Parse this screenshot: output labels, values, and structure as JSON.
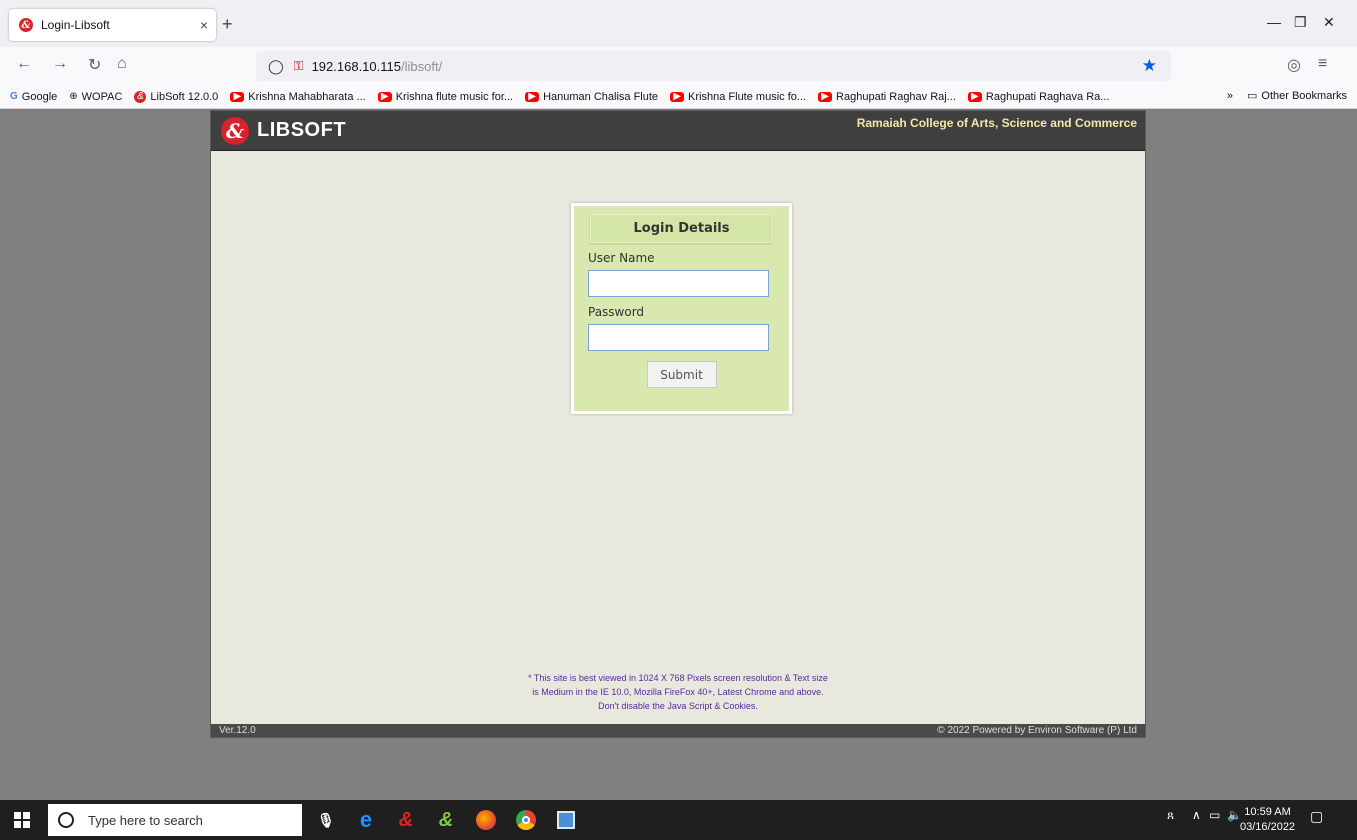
{
  "browser": {
    "tab_title": "Login-Libsoft",
    "tab_close": "×",
    "new_tab": "+",
    "url_host": "192.168.10.115",
    "url_path": "/libsoft/",
    "bookmarks": [
      {
        "label": "Google",
        "icon": "google-icon"
      },
      {
        "label": "WOPAC",
        "icon": "globe-icon"
      },
      {
        "label": "LibSoft 12.0.0",
        "icon": "libsoft-icon"
      },
      {
        "label": "Krishna Mahabharata ...",
        "icon": "youtube-icon"
      },
      {
        "label": "Krishna flute music for...",
        "icon": "youtube-icon"
      },
      {
        "label": "Hanuman Chalisa Flute",
        "icon": "youtube-icon"
      },
      {
        "label": "Krishna Flute music fo...",
        "icon": "youtube-icon"
      },
      {
        "label": "Raghupati Raghav Raj...",
        "icon": "youtube-icon"
      },
      {
        "label": "Raghupati Raghava Ra...",
        "icon": "youtube-icon"
      }
    ],
    "other_bookmarks": "Other Bookmarks"
  },
  "header": {
    "logo_text": "LIBSOFT",
    "college": "Ramaiah College of Arts, Science and Commerce"
  },
  "login": {
    "title": "Login Details",
    "username_label": "User Name",
    "username_value": "",
    "password_label": "Password",
    "password_value": "",
    "submit_label": "Submit"
  },
  "note": {
    "line1": "* This site is best viewed in 1024 X 768 Pixels screen resolution & Text size",
    "line2": "is Medium in the IE 10.0, Mozilla FireFox 40+, Latest Chrome and above.",
    "line3": "Don't disable the Java Script & Cookies."
  },
  "footer": {
    "version": "Ver.12.0",
    "copyright": "©  2022   Powered by Environ Software (P) Ltd"
  },
  "taskbar": {
    "search_placeholder": "Type here to search",
    "time": "10:59 AM",
    "date": "03/16/2022"
  },
  "colors": {
    "header_bg": "#3f3f3f",
    "college_text": "#f2e8a8",
    "login_bg": "#d9e8ae",
    "page_bg": "#e9e8df",
    "note_text": "#5a2a96"
  }
}
